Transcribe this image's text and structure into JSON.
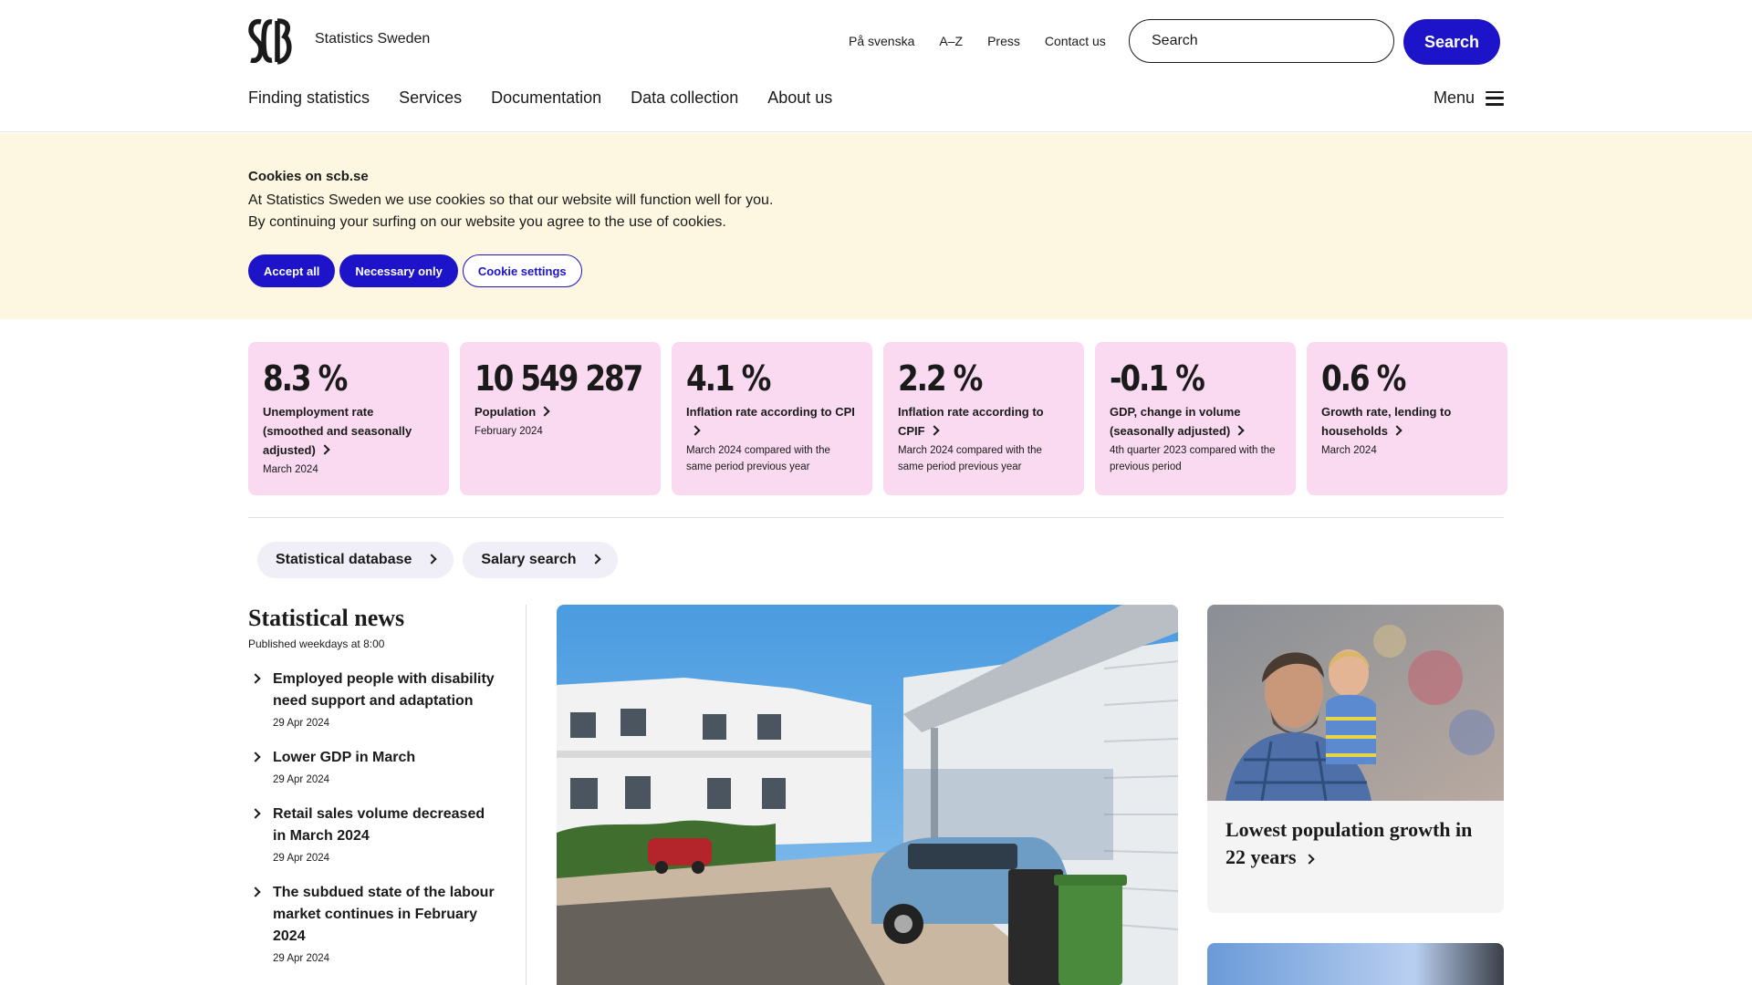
{
  "header": {
    "site_name": "Statistics Sweden",
    "top_links": [
      "På svenska",
      "A–Z",
      "Press",
      "Contact us"
    ],
    "search_placeholder": "Search",
    "search_button": "Search",
    "nav": [
      "Finding statistics",
      "Services",
      "Documentation",
      "Data collection",
      "About us"
    ],
    "menu_label": "Menu"
  },
  "cookie": {
    "title": "Cookies on scb.se",
    "line1": "At Statistics Sweden we use cookies so that our website will function well for you.",
    "line2": "By continuing your surfing on our website you agree to the use of cookies.",
    "accept_all": "Accept all",
    "necessary_only": "Necessary only",
    "settings": "Cookie settings"
  },
  "key_figures": [
    {
      "value": "8.3 %",
      "label": "Unemployment rate\n (smoothed and seasonally adjusted)",
      "sub": "March 2024"
    },
    {
      "value": "10 549 287",
      "label": "Population",
      "sub": "February 2024"
    },
    {
      "value": "4.1 %",
      "label": "Inflation rate according to CPI",
      "sub": "March 2024 compared with the same period previous year"
    },
    {
      "value": "2.2 %",
      "label": "Inflation rate according to CPIF",
      "sub": "March 2024 compared with the same period previous year"
    },
    {
      "value": "-0.1 %",
      "label": "GDP, change in volume (seasonally adjusted)",
      "sub": "4th quarter 2023 compared with the previous period"
    },
    {
      "value": "0.6 %",
      "label": "Growth rate, lending to households",
      "sub": "March 2024"
    }
  ],
  "quick_links": [
    "Statistical database",
    "Salary search"
  ],
  "news": {
    "title": "Statistical news",
    "subtitle": "Published weekdays at 8:00",
    "items": [
      {
        "title": "Employed people with disability need support and adaptation",
        "date": "29 Apr 2024"
      },
      {
        "title": "Lower GDP in March",
        "date": "29 Apr 2024"
      },
      {
        "title": "Retail sales volume decreased in March 2024",
        "date": "29 Apr 2024"
      },
      {
        "title": "The subdued state of the labour market continues in February 2024",
        "date": "29 Apr 2024"
      }
    ]
  },
  "feature": {
    "title": "Lowest population growth in 22 years"
  },
  "colors": {
    "brand": "#1d14c9",
    "cookie_bg": "#fdf7e1",
    "card_bg": "#f9daf1"
  }
}
